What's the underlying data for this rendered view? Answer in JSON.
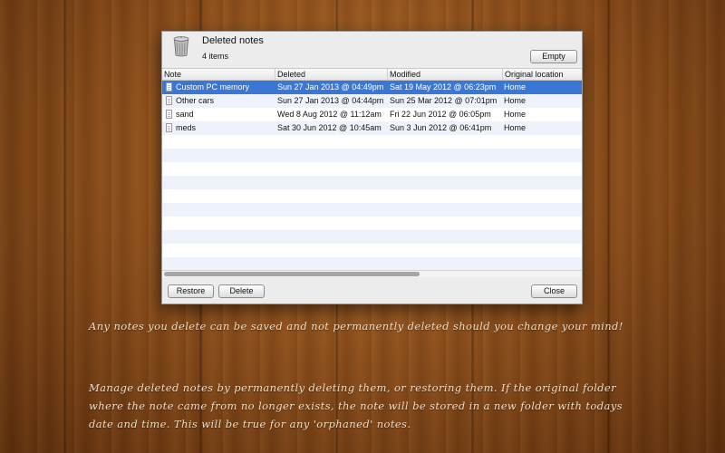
{
  "dialog": {
    "title": "Deleted notes",
    "count": "4 items",
    "empty_label": "Empty",
    "restore_label": "Restore",
    "delete_label": "Delete",
    "close_label": "Close",
    "icon": "trash-can-icon"
  },
  "table": {
    "columns": [
      "Note",
      "Deleted",
      "Modified",
      "Original location"
    ],
    "rows": [
      {
        "note": "Custom PC memory",
        "deleted": "Sun 27 Jan 2013 @ 04:49pm",
        "modified": "Sat 19 May 2012 @ 06:23pm",
        "location": "Home",
        "selected": true
      },
      {
        "note": "Other cars",
        "deleted": "Sun 27 Jan 2013 @ 04:44pm",
        "modified": "Sun 25 Mar 2012 @ 07:01pm",
        "location": "Home"
      },
      {
        "note": "sand",
        "deleted": "Wed 8 Aug 2012 @ 11:12am",
        "modified": "Fri 22 Jun 2012 @ 06:05pm",
        "location": "Home"
      },
      {
        "note": "meds",
        "deleted": "Sat 30 Jun 2012 @ 10:45am",
        "modified": "Sun 3 Jun 2012 @ 06:41pm",
        "location": "Home"
      }
    ],
    "row_icon": "note-document-icon",
    "selected_color": "#3a77d4"
  },
  "captions": {
    "line1": "Any notes you delete can be saved and not permanently deleted should you change your mind!",
    "line2": "Manage deleted notes by permanently deleting them, or restoring them. If the original folder where the note came from no longer exists, the note will be stored in a new folder with todays date and time. This will be true for any 'orphaned' notes."
  }
}
